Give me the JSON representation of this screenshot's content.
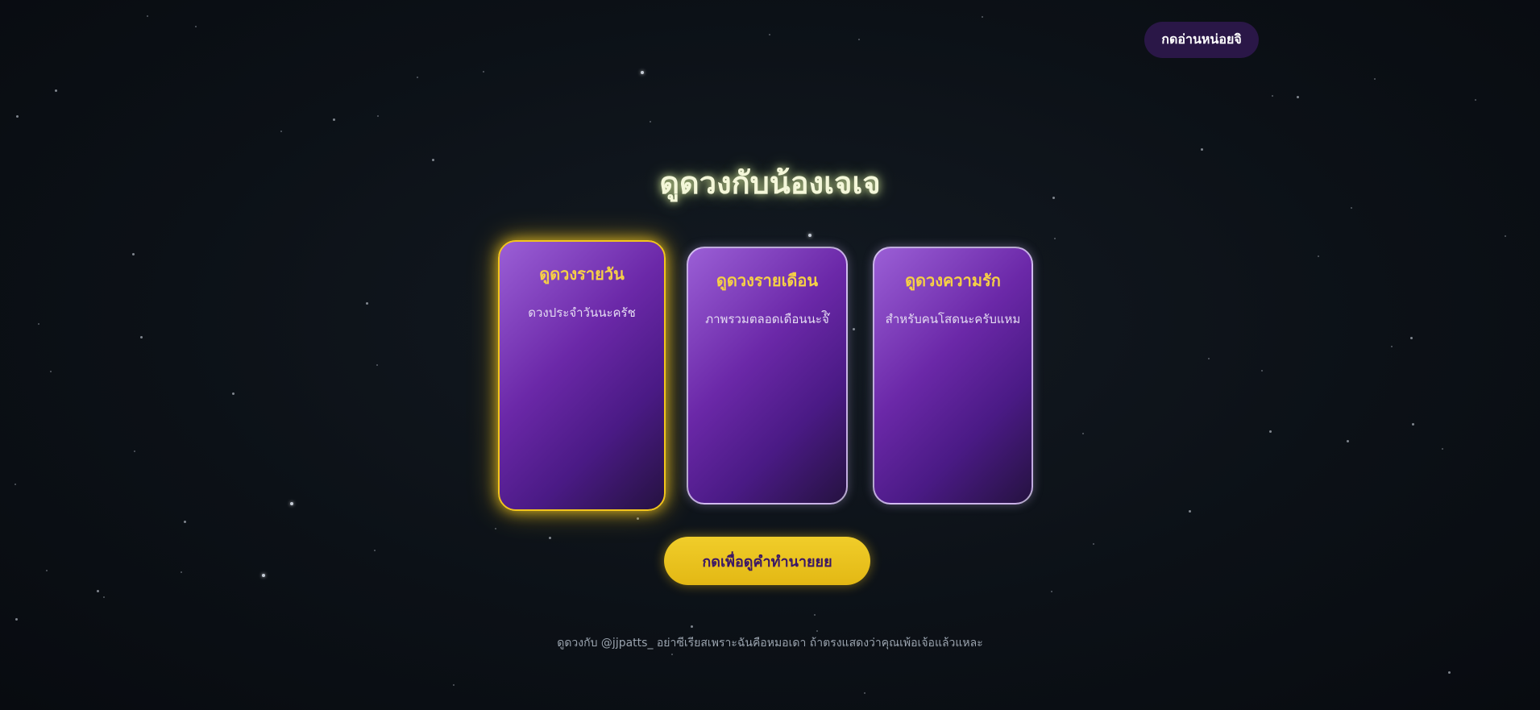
{
  "top_button": {
    "label": "กดอ่านหน่อยจิ"
  },
  "title": "ดูดวงกับน้องเจเจ",
  "cards": [
    {
      "title": "ดูดวงรายวัน",
      "subtitle": "ดวงประจำวันนะครัช",
      "selected": true
    },
    {
      "title": "ดูดวงรายเดือน",
      "subtitle": "ภาพรวมตลอดเดือนนะจ๊ิ",
      "selected": false
    },
    {
      "title": "ดูดวงความรัก",
      "subtitle": "สำหรับคนโสดนะครับแหม",
      "selected": false
    }
  ],
  "cta_button": {
    "label": "กดเพื่อดูคำทำนายยย"
  },
  "footer": "ดูดวงกับ @jjpatts_ อย่าซีเรียสเพราะฉันคือหมอเดา ถ้าตรงแสดงว่าคุณเพ้อเจ้อแล้วแหละ",
  "colors": {
    "accent_gold": "#f2c51d",
    "card_purple": "#6b28a8",
    "title_glow": "#f4f7d9",
    "background": "#0c1117"
  }
}
